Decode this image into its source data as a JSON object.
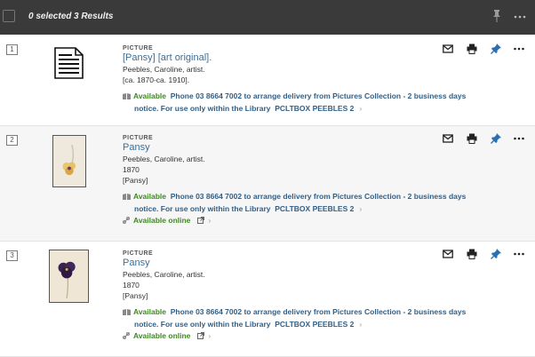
{
  "toolbar": {
    "selected_label": "0 selected",
    "results_label": "3 Results",
    "pin_icon": "pin-icon",
    "more_icon": "more-icon"
  },
  "records": [
    {
      "index": "1",
      "type": "PICTURE",
      "title": "[Pansy] [art original].",
      "lines": [
        "Peebles, Caroline, artist.",
        "[ca. 1870-ca. 1910]."
      ],
      "availability": {
        "status": "Available",
        "message_part1": "Phone 03 8664 7002 to arrange delivery from Pictures Collection - 2 business days",
        "message_part2": "notice. For use only within the Library",
        "location": "PCLTBOX PEEBLES 2"
      },
      "online": null
    },
    {
      "index": "2",
      "type": "PICTURE",
      "title": "Pansy",
      "lines": [
        "Peebles, Caroline, artist.",
        "1870",
        "[Pansy]"
      ],
      "availability": {
        "status": "Available",
        "message_part1": "Phone 03 8664 7002 to arrange delivery from Pictures Collection - 2 business days",
        "message_part2": "notice. For use only within the Library",
        "location": "PCLTBOX PEEBLES 2"
      },
      "online": "Available online"
    },
    {
      "index": "3",
      "type": "PICTURE",
      "title": "Pansy",
      "lines": [
        "Peebles, Caroline, artist.",
        "1870",
        "[Pansy]"
      ],
      "availability": {
        "status": "Available",
        "message_part1": "Phone 03 8664 7002 to arrange delivery from Pictures Collection - 2 business days",
        "message_part2": "notice. For use only within the Library",
        "location": "PCLTBOX PEEBLES 2"
      },
      "online": "Available online"
    }
  ],
  "action_icons": [
    "email-icon",
    "print-icon",
    "pin-icon",
    "more-icon"
  ],
  "colors": {
    "topbar": "#3a3a3a",
    "title_link": "#3e6d95",
    "available_green": "#3d8a1f",
    "pin_blue": "#2a6fb0"
  }
}
